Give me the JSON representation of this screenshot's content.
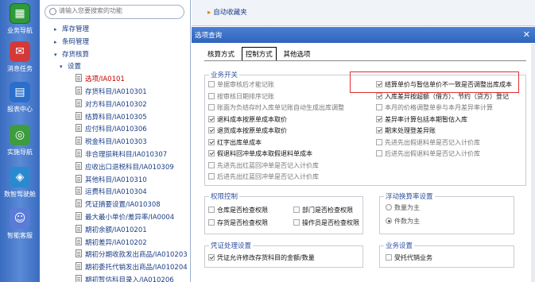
{
  "nav": [
    {
      "label": "业务导航",
      "icon": "business-nav-icon",
      "glyph": "▦"
    },
    {
      "label": "消息任务",
      "icon": "message-task-icon",
      "glyph": "✉"
    },
    {
      "label": "报表中心",
      "icon": "report-center-icon",
      "glyph": "▤"
    },
    {
      "label": "实施导航",
      "icon": "implement-nav-icon",
      "glyph": "◎"
    },
    {
      "label": "数智驾驶舱",
      "icon": "cockpit-icon",
      "glyph": "◈"
    },
    {
      "label": "智能客服",
      "icon": "support-icon",
      "glyph": "☺"
    }
  ],
  "search": {
    "placeholder": "请输入您要搜索的功能"
  },
  "tree": [
    {
      "label": "库存管理",
      "level": 1,
      "arrow": "▸"
    },
    {
      "label": "条码管理",
      "level": 1,
      "arrow": "▸"
    },
    {
      "label": "存货核算",
      "level": 1,
      "arrow": "▾"
    },
    {
      "label": "设置",
      "level": 2,
      "arrow": "▾"
    },
    {
      "label": "选项/IA0101",
      "level": 3,
      "selected": true
    },
    {
      "label": "存货科目/IA010301",
      "level": 3
    },
    {
      "label": "对方科目/IA010302",
      "level": 3
    },
    {
      "label": "结算科目/IA010305",
      "level": 3
    },
    {
      "label": "应付科目/IA010306",
      "level": 3
    },
    {
      "label": "税金科目/IA010303",
      "level": 3
    },
    {
      "label": "非合理损耗科目/IA010307",
      "level": 3
    },
    {
      "label": "应收出口退税科目/IA010309",
      "level": 3
    },
    {
      "label": "其他科目/IA010310",
      "level": 3
    },
    {
      "label": "运费科目/IA010304",
      "level": 3
    },
    {
      "label": "凭证摘要设置/IA010308",
      "level": 3
    },
    {
      "label": "最大最小单价/差异率/IA0004",
      "level": 3
    },
    {
      "label": "期初余额/IA010201",
      "level": 3
    },
    {
      "label": "期初差异/IA010202",
      "level": 3
    },
    {
      "label": "期初分期收款发出商品/IA010203",
      "level": 3
    },
    {
      "label": "期初委托代销发出商品/IA010204",
      "level": 3
    },
    {
      "label": "期初暂估科目录入/IA010206",
      "level": 3
    }
  ],
  "favorites": {
    "label": "自动收藏夹"
  },
  "dialog": {
    "title": "选项查询",
    "close": "✕",
    "tabs": [
      {
        "label": "核算方式",
        "active": false
      },
      {
        "label": "控制方式",
        "active": true
      },
      {
        "label": "其他选项",
        "active": false
      }
    ],
    "groups": {
      "business": "业务开关",
      "permission": "权限控制",
      "float": "浮动换算率设置",
      "voucher": "凭证处理设置",
      "busi2": "业务设置"
    },
    "business_left": [
      {
        "label": "单据审核后才能记账",
        "checked": false,
        "enabled": false
      },
      {
        "label": "按审核日期排序记账",
        "checked": false,
        "enabled": false
      },
      {
        "label": "账面为负结存时入库单记账自动生成出库调整",
        "checked": false,
        "enabled": false
      },
      {
        "label": "退料成本按原单成本取价",
        "checked": true,
        "enabled": true
      },
      {
        "label": "退货成本按原单成本取价",
        "checked": true,
        "enabled": true
      },
      {
        "label": "红字出库单成本",
        "checked": true,
        "enabled": true
      },
      {
        "label": "假退料回冲单成本取假退料单成本",
        "checked": true,
        "enabled": true
      },
      {
        "label": "先进先出红蓝回冲单是否记入计价库",
        "checked": false,
        "enabled": false
      },
      {
        "label": "后进先出红蓝回冲单是否记入计价库",
        "checked": false,
        "enabled": false
      }
    ],
    "business_right": [
      {
        "label": "结算单价与暂估单价不一致是否调整出库成本",
        "checked": true,
        "enabled": true
      },
      {
        "label": "入库差异按超额（借方）、节约（贷方）登记",
        "checked": true,
        "enabled": true
      },
      {
        "label": "本月的价格调整单参与本月差异率计算",
        "checked": false,
        "enabled": false
      },
      {
        "label": "差异率计算包括本期暂估入库",
        "checked": true,
        "enabled": true
      },
      {
        "label": "期末处理登差异账",
        "checked": true,
        "enabled": true
      },
      {
        "label": "先进先出假退料单是否记入计价库",
        "checked": false,
        "enabled": false
      },
      {
        "label": "后进先出假退料单是否记入计价库",
        "checked": false,
        "enabled": false
      }
    ],
    "permission": [
      {
        "label": "仓库是否检查权限",
        "checked": false
      },
      {
        "label": "部门是否检查权限",
        "checked": false
      },
      {
        "label": "存货是否检查权限",
        "checked": false
      },
      {
        "label": "操作员是否检查权限",
        "checked": false
      }
    ],
    "float_options": [
      {
        "label": "数量为主",
        "selected": false
      },
      {
        "label": "件数为主",
        "selected": true
      }
    ],
    "voucher": {
      "label": "凭证允许修改存货科目的金额/数量",
      "checked": true
    },
    "busi2": {
      "label": "受托代销业务",
      "checked": false
    }
  }
}
